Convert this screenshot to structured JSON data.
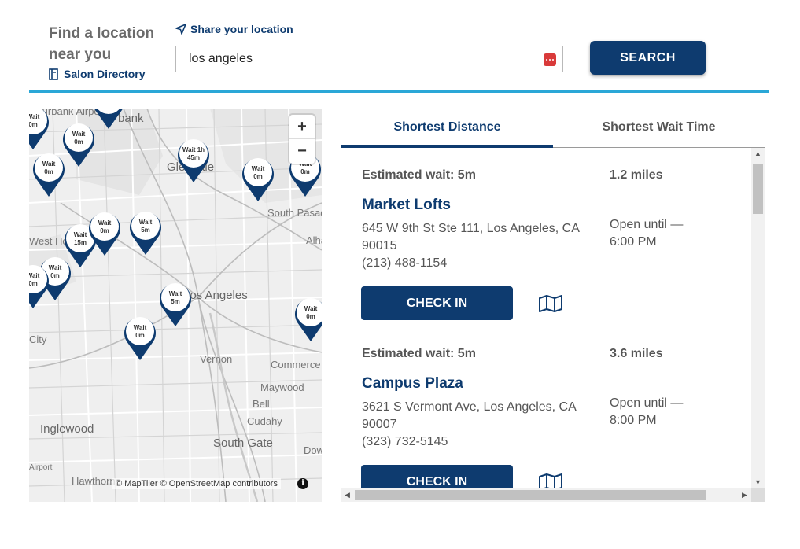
{
  "header": {
    "title": "Find a location near you",
    "directory_link": "Salon Directory",
    "share_link": "Share your location",
    "search_value": "los angeles",
    "search_button": "SEARCH"
  },
  "map": {
    "zoom_in": "+",
    "zoom_out": "−",
    "attribution": "© MapTiler © OpenStreetMap contributors",
    "info": "i",
    "labels": [
      "Burbank Airport",
      "bank",
      "Glendale",
      "South Pasadena",
      "Alhambra",
      "Los Angeles",
      "City",
      "Vernon",
      "Commerce",
      "Maywood",
      "Bell",
      "Cudahy",
      "Inglewood",
      "South Gate",
      "Downey",
      "Hawthorne",
      "Airport",
      "West Hollywood"
    ],
    "pins": [
      {
        "l1": "Wait",
        "l2": "0m"
      },
      {
        "l1": "Wait 1h",
        "l2": "45m"
      },
      {
        "l1": "Wait",
        "l2": "0m"
      },
      {
        "l1": "Wait",
        "l2": "0m"
      },
      {
        "l1": "Wait",
        "l2": "0m"
      },
      {
        "l1": "Wait",
        "l2": "0m"
      },
      {
        "l1": "Wait",
        "l2": "0m"
      },
      {
        "l1": "Wait",
        "l2": "15m"
      },
      {
        "l1": "Wait",
        "l2": "0m"
      },
      {
        "l1": "Wait",
        "l2": "5m"
      },
      {
        "l1": "Wait",
        "l2": "5m"
      },
      {
        "l1": "Wait",
        "l2": "0m"
      },
      {
        "l1": "Wait",
        "l2": "0m"
      },
      {
        "l1": "Wait",
        "l2": "0m"
      },
      {
        "l1": "Wait",
        "l2": "0m"
      }
    ]
  },
  "tabs": [
    {
      "label": "Shortest Distance",
      "active": true
    },
    {
      "label": "Shortest Wait Time",
      "active": false
    }
  ],
  "results": [
    {
      "estimated_wait": "Estimated wait: 5m",
      "distance": "1.2 miles",
      "name": "Market Lofts",
      "address": "645 W 9th St Ste 111, Los Angeles, CA 90015",
      "phone": "(213) 488-1154",
      "hours": "Open until — 6:00 PM",
      "button": "CHECK IN"
    },
    {
      "estimated_wait": "Estimated wait: 5m",
      "distance": "3.6 miles",
      "name": "Campus Plaza",
      "address": "3621 S Vermont Ave, Los Angeles, CA 90007",
      "phone": "(323) 732-5145",
      "hours": "Open until — 8:00 PM",
      "button": "CHECK IN"
    }
  ],
  "colors": {
    "brand_navy": "#0e3b6f",
    "accent_blue": "#2aa7d7",
    "password_icon_red": "#d93a3a"
  },
  "icons": {
    "share": "location-arrow-icon",
    "directory": "directory-icon",
    "password_manager": "password-manager-icon",
    "map_view": "folded-map-icon",
    "pin": "map-pin-icon"
  }
}
